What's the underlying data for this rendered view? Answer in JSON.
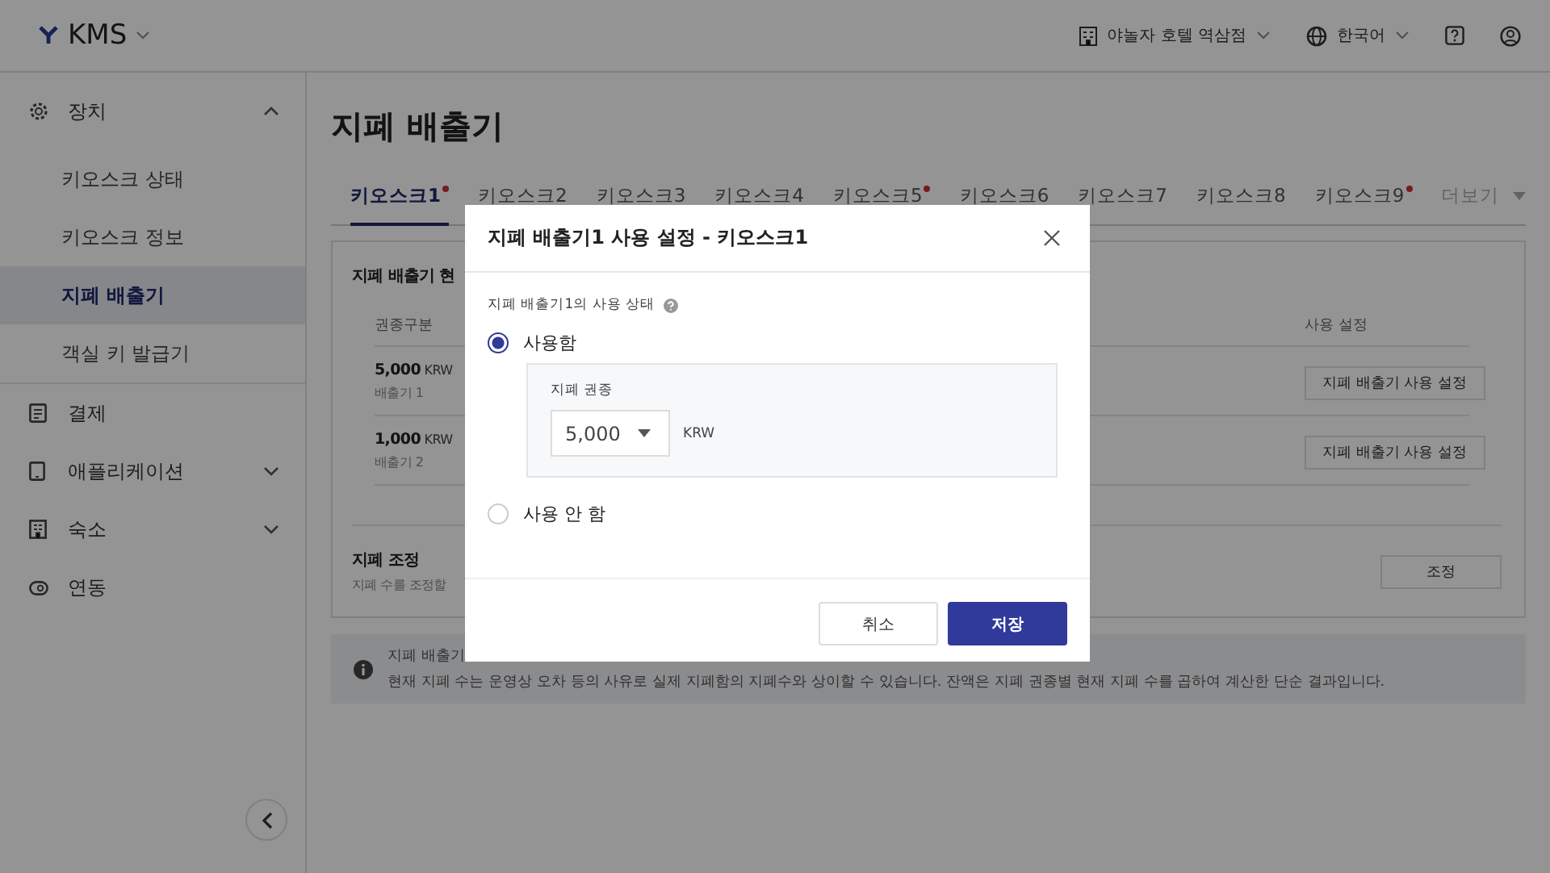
{
  "app": {
    "name": "KMS"
  },
  "header": {
    "property": "야놀자 호텔 역삼점",
    "language": "한국어"
  },
  "sidebar": {
    "items": [
      {
        "label": "장치",
        "kind": "group",
        "expanded": true,
        "children": [
          {
            "label": "키오스크 상태",
            "selected": false
          },
          {
            "label": "키오스크 정보",
            "selected": false
          },
          {
            "label": "지폐 배출기",
            "selected": true
          },
          {
            "label": "객실 키 발급기",
            "selected": false
          }
        ]
      },
      {
        "label": "결제",
        "kind": "link"
      },
      {
        "label": "애플리케이션",
        "kind": "group",
        "expanded": false
      },
      {
        "label": "숙소",
        "kind": "group",
        "expanded": false
      },
      {
        "label": "연동",
        "kind": "link"
      }
    ]
  },
  "page_title": "지폐 배출기",
  "tabs": [
    {
      "label": "키오스크1",
      "alert": true,
      "selected": true
    },
    {
      "label": "키오스크2",
      "alert": false,
      "selected": false
    },
    {
      "label": "키오스크3",
      "alert": false,
      "selected": false
    },
    {
      "label": "키오스크4",
      "alert": false,
      "selected": false
    },
    {
      "label": "키오스크5",
      "alert": true,
      "selected": false
    },
    {
      "label": "키오스크6",
      "alert": false,
      "selected": false
    },
    {
      "label": "키오스크7",
      "alert": false,
      "selected": false
    },
    {
      "label": "키오스크8",
      "alert": false,
      "selected": false
    },
    {
      "label": "키오스크9",
      "alert": true,
      "selected": false
    }
  ],
  "more_tab": {
    "label": "더보기",
    "disabled": true
  },
  "status": {
    "title": "지폐 배출기 현",
    "columns": [
      "권종구분",
      "사용 설정"
    ],
    "rows": [
      {
        "amount": "5,000",
        "unit": "KRW",
        "name": "배출기 1",
        "action": "지폐 배출기 사용 설정"
      },
      {
        "amount": "1,000",
        "unit": "KRW",
        "name": "배출기 2",
        "action": "지폐 배출기 사용 설정"
      }
    ]
  },
  "adjust": {
    "title": "지폐 조정",
    "description": "지폐 수를 조정할",
    "button": "조정"
  },
  "info": {
    "lines": [
      "지폐 배출기",
      "현재 지폐 수는 운영상 오차 등의 사유로 실제 지폐함의 지폐수와 상이할 수 있습니다. 잔액은 지폐 권종별 현재 지폐 수를 곱하여 계산한 단순 결과입니다."
    ]
  },
  "modal": {
    "title": "지폐 배출기1 사용 설정 - 키오스크1",
    "field_label": "지폐 배출기1의 사용 상태",
    "options": [
      {
        "label": "사용함",
        "selected": true
      },
      {
        "label": "사용 안 함",
        "selected": false
      }
    ],
    "denomination": {
      "label": "지폐 권종",
      "value": "5,000",
      "unit": "KRW"
    },
    "buttons": [
      {
        "label": "취소",
        "kind": "secondary"
      },
      {
        "label": "저장",
        "kind": "primary"
      }
    ]
  }
}
